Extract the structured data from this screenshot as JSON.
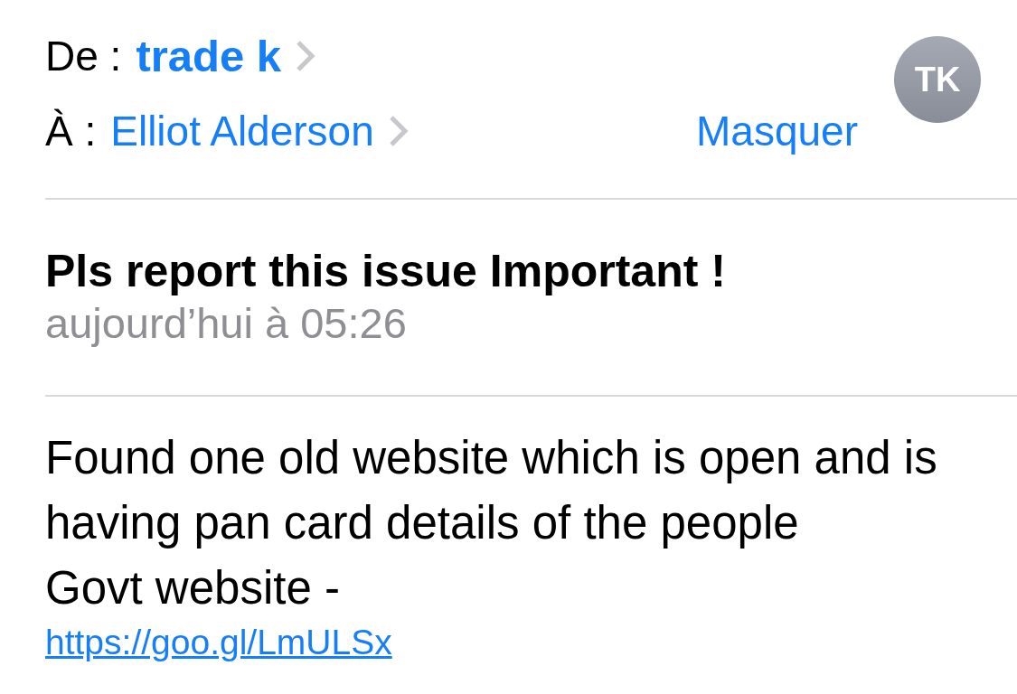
{
  "header": {
    "from": {
      "label": "De :",
      "name": "trade k"
    },
    "to": {
      "label": "À :",
      "name": "Elliot Alderson"
    },
    "hide_button": "Masquer",
    "avatar": {
      "initials": "TK"
    }
  },
  "message": {
    "subject": "Pls report this issue Important !",
    "date": "aujourd’hui à 05:26"
  },
  "body": {
    "paragraphs": [
      "Found one old website which is open and is having pan card details of the people",
      "Govt website -"
    ],
    "link": "https://goo.gl/LmULSx"
  }
}
